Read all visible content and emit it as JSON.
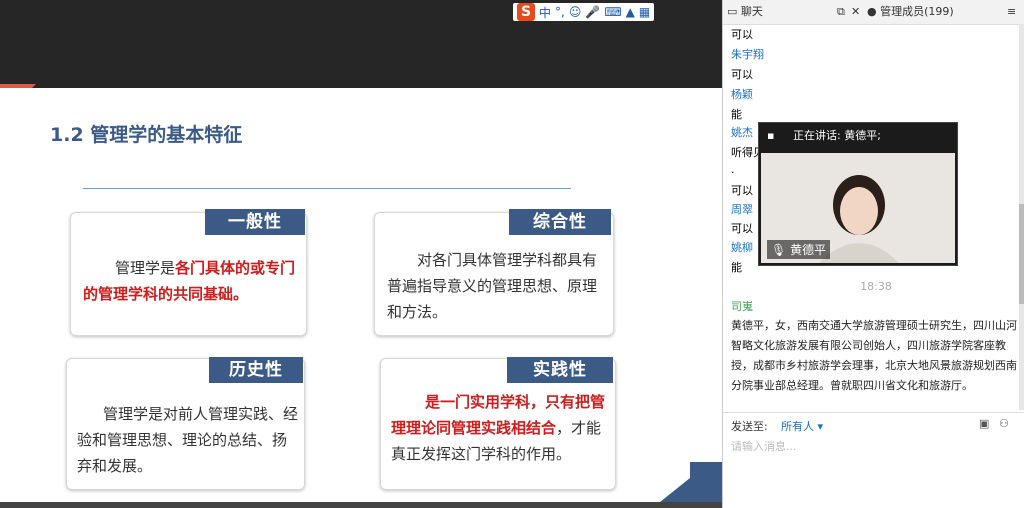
{
  "ime": {
    "brand": "S",
    "mode": "中",
    "punct": "°,"
  },
  "slide": {
    "title": "1.2 管理学的基本特征",
    "cards": [
      {
        "tag": "一般性",
        "text_plain": "管理学是",
        "text_red": "各门具体的或专门的管理学科的共同基础。"
      },
      {
        "tag": "综合性",
        "text_plain": "对各门具体管理学科都具有普遍指导意义的管理思想、原理和方法。"
      },
      {
        "tag": "历史性",
        "text_plain": "管理学是对前人管理实践、经验和管理思想、理论的总结、扬弃和发展。"
      },
      {
        "tag": "实践性",
        "text_red": "是一门实用学科，只有把管理理论同管理实践相结合",
        "text_plain": "，才能真正发挥这门学科的作用。"
      }
    ]
  },
  "panel": {
    "tab_chat": "聊天",
    "tab_members": "管理成员(199)",
    "messages": [
      {
        "text": "可以"
      },
      {
        "name": "朱宇翔",
        "text": "可以"
      },
      {
        "name": "杨颖",
        "text": "能"
      },
      {
        "name": "姚杰",
        "text": "听得见"
      },
      {
        "text": "."
      },
      {
        "text": "可以"
      },
      {
        "name": "周翠",
        "text": "可以"
      },
      {
        "name": "姚柳",
        "text": "能"
      }
    ],
    "time": "18:38",
    "sys_name": "司嵬",
    "sys_text": "黄德平，女，西南交通大学旅游管理硕士研究生，四川山河智略文化旅游发展有限公司创始人，四川旅游学院客座教授，成都市乡村旅游学会理事，北京大地风景旅游规划西南分院事业部总经理。曾就职四川省文化和旅游厅。",
    "send_label": "发送至:",
    "send_target": "所有人",
    "input_placeholder": "请输入消息..."
  },
  "video": {
    "speaking": "正在讲话: 黄德平;",
    "speaker": "黄德平"
  }
}
